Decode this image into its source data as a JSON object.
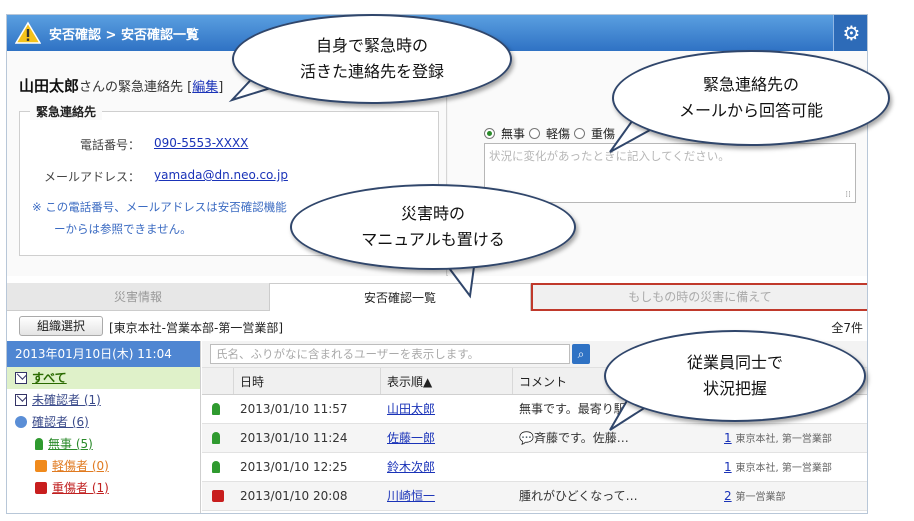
{
  "header": {
    "breadcrumb": "安否確認 > 安否確認一覧"
  },
  "profile": {
    "name": "山田太郎",
    "suffix": "さんの緊急連絡先 [",
    "edit": "編集",
    "close_bracket": "]",
    "section_title": "緊急連絡先",
    "phone_label": "電話番号：",
    "phone_value": "090-5553-XXXX",
    "mail_label": "メールアドレス：",
    "mail_value": "yamada@dn.neo.co.jp",
    "note_line1": "※ この電話番号、メールアドレスは安否確認機能",
    "note_line2": "ーからは参照できません。"
  },
  "status_form": {
    "options": [
      "無事",
      "軽傷",
      "重傷"
    ],
    "placeholder": "状況に変化があったときに記入してください。"
  },
  "tabs": [
    "災害情報",
    "安否確認一覧",
    "もしもの時の災害に備えて"
  ],
  "toolbar": {
    "org_button": "組織選択",
    "org_label": "[東京本社-営業本部-第一営業部]",
    "count": "全7件"
  },
  "sidebar": {
    "date": "2013年01月10日(木) 11:04",
    "items": [
      {
        "label": "すべて"
      },
      {
        "label": "未確認者 (1)"
      },
      {
        "label": "確認者 (6)"
      },
      {
        "label": "無事 (5)"
      },
      {
        "label": "軽傷者 (0)"
      },
      {
        "label": "重傷者 (1)"
      }
    ]
  },
  "search": {
    "placeholder": "氏名、ふりがなに含まれるユーザーを表示します。"
  },
  "grid": {
    "headers": [
      "日時",
      "表示順▲",
      "コメント"
    ],
    "rows": [
      {
        "date": "2013/01/10 11:57",
        "name": "山田太郎",
        "comment": "無事です。最寄り駅…",
        "num": "",
        "org": ""
      },
      {
        "date": "2013/01/10 11:24",
        "name": "佐藤一郎",
        "comment": "斉藤です。佐藤…",
        "num": "1",
        "org": "東京本社, 第一営業部"
      },
      {
        "date": "2013/01/10 12:25",
        "name": "鈴木次郎",
        "comment": "",
        "num": "1",
        "org": "東京本社, 第一営業部"
      },
      {
        "date": "2013/01/10 20:08",
        "name": "川崎恒一",
        "comment": "腫れがひどくなって…",
        "num": "2",
        "org": "第一営業部"
      }
    ]
  },
  "callouts": {
    "c1_line1": "自身で緊急時の",
    "c1_line2": "活きた連絡先を登録",
    "c2_line1": "緊急連絡先の",
    "c2_line2": "メールから回答可能",
    "c3_line1": "災害時の",
    "c3_line2": "マニュアルも置ける",
    "c4_line1": "従業員同士で",
    "c4_line2": "状況把握"
  },
  "colors": {
    "title_bar": "#2f72c4",
    "date_bar": "#4f86d2",
    "accent_red": "#c0392b"
  }
}
